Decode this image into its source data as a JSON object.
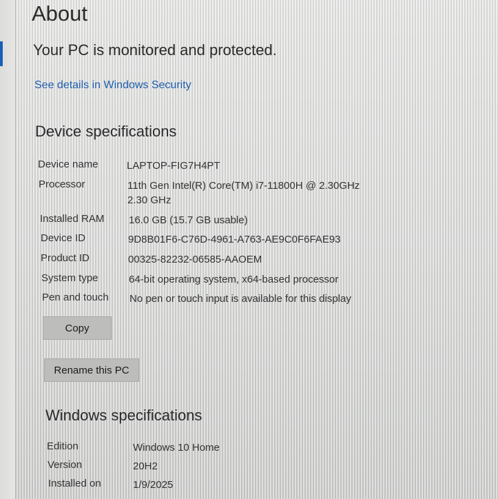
{
  "page": {
    "title": "About",
    "protection_status": "Your PC is monitored and protected.",
    "security_link": "See details in Windows Security"
  },
  "device_specs": {
    "heading": "Device specifications",
    "rows": [
      {
        "label": "Device name",
        "value": [
          "LAPTOP-FIG7H4PT"
        ]
      },
      {
        "label": "Processor",
        "value": [
          "11th Gen Intel(R) Core(TM) i7-11800H @ 2.30GHz",
          "2.30 GHz"
        ]
      },
      {
        "label": "Installed RAM",
        "value": [
          "16.0 GB (15.7 GB usable)"
        ]
      },
      {
        "label": "Device ID",
        "value": [
          "9D8B01F6-C76D-4961-A763-AE9C0F6FAE93"
        ]
      },
      {
        "label": "Product ID",
        "value": [
          "00325-82232-06585-AAOEM"
        ]
      },
      {
        "label": "System type",
        "value": [
          "64-bit operating system, x64-based processor"
        ]
      },
      {
        "label": "Pen and touch",
        "value": [
          "No pen or touch input is available for this display"
        ]
      }
    ],
    "copy_label": "Copy",
    "rename_label": "Rename this PC"
  },
  "windows_specs": {
    "heading": "Windows specifications",
    "rows": [
      {
        "label": "Edition",
        "value": [
          "Windows 10 Home"
        ]
      },
      {
        "label": "Version",
        "value": [
          "20H2"
        ]
      },
      {
        "label": "Installed on",
        "value": [
          "1/9/2025"
        ]
      }
    ]
  }
}
